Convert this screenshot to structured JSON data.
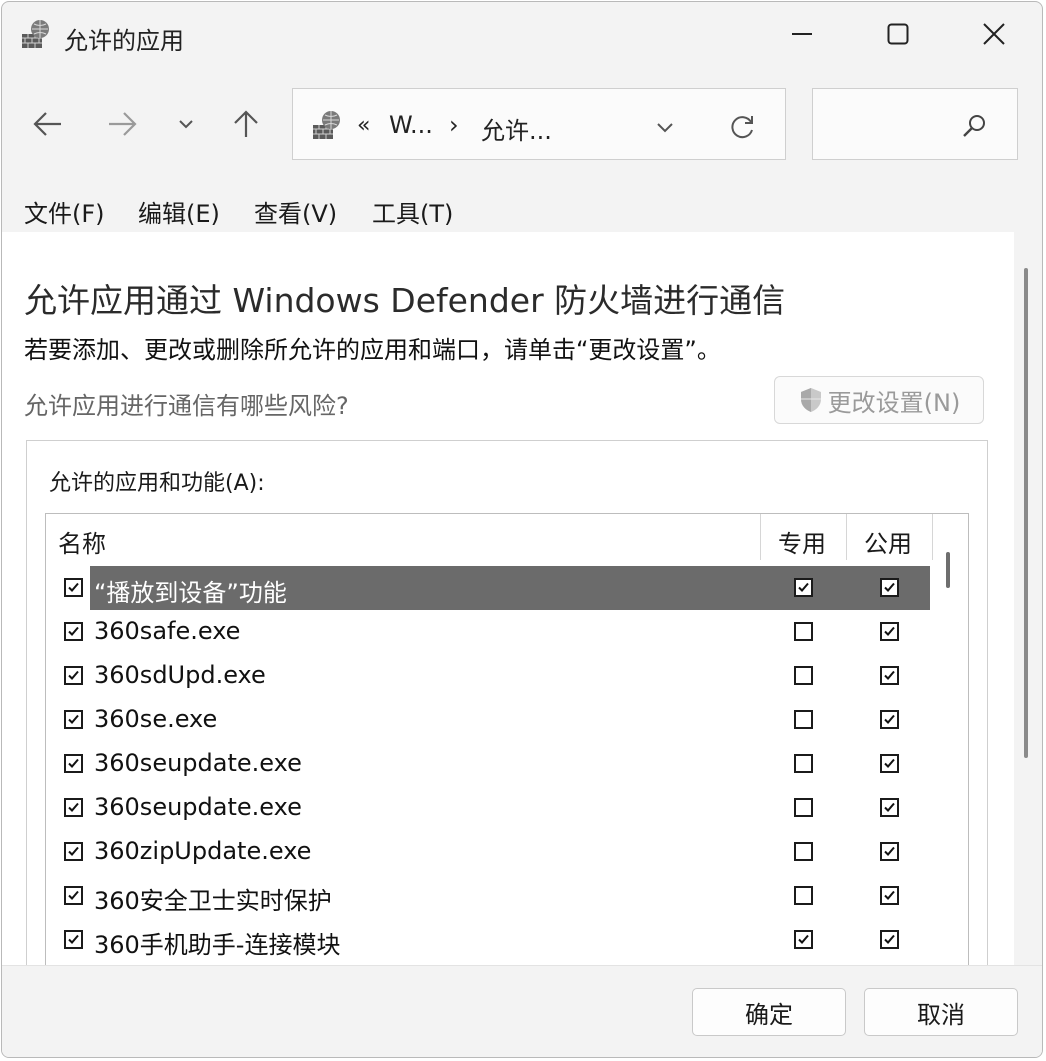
{
  "window": {
    "title": "允许的应用",
    "controls": {
      "minimize": "minimize-icon",
      "maximize": "maximize-icon",
      "close": "close-icon"
    }
  },
  "nav": {
    "back_icon": "arrow-left-icon",
    "forward_icon": "arrow-right-icon",
    "recent_icon": "chevron-down-icon",
    "up_icon": "arrow-up-icon",
    "address": {
      "overflow": "«",
      "segment1": "W...",
      "separator": "›",
      "segment2": "允许..."
    },
    "refresh_icon": "refresh-icon",
    "search_icon": "search-icon"
  },
  "menu": {
    "file": "文件(F)",
    "edit": "编辑(E)",
    "view": "查看(V)",
    "tools": "工具(T)"
  },
  "main": {
    "heading": "允许应用通过 Windows Defender 防火墙进行通信",
    "subtext": "若要添加、更改或删除所允许的应用和端口，请单击“更改设置”。",
    "risk_link": "允许应用进行通信有哪些风险?",
    "change_settings": "更改设置(N)"
  },
  "apps_group": {
    "label": "允许的应用和功能(A):",
    "columns": {
      "name": "名称",
      "private": "专用",
      "public": "公用"
    },
    "rows": [
      {
        "name": "“播放到设备”功能",
        "enabled": true,
        "private": true,
        "public": true,
        "selected": true
      },
      {
        "name": "360safe.exe",
        "enabled": true,
        "private": false,
        "public": true
      },
      {
        "name": "360sdUpd.exe",
        "enabled": true,
        "private": false,
        "public": true
      },
      {
        "name": "360se.exe",
        "enabled": true,
        "private": false,
        "public": true
      },
      {
        "name": "360seupdate.exe",
        "enabled": true,
        "private": false,
        "public": true
      },
      {
        "name": "360seupdate.exe",
        "enabled": true,
        "private": false,
        "public": true
      },
      {
        "name": "360zipUpdate.exe",
        "enabled": true,
        "private": false,
        "public": true
      },
      {
        "name": "360安全卫士实时保护",
        "enabled": true,
        "private": false,
        "public": true
      },
      {
        "name": "360手机助手-连接模块",
        "enabled": true,
        "private": true,
        "public": true
      }
    ]
  },
  "footer": {
    "ok": "确定",
    "cancel": "取消"
  }
}
